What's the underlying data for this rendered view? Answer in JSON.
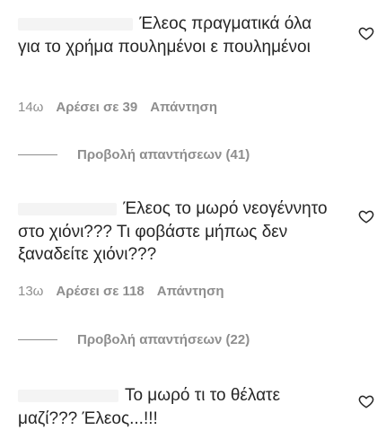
{
  "comments": [
    {
      "text": "Έλεος πραγματικά όλα για το χρήμα πουλημένοι ε πουλημένοι",
      "age": "14ω",
      "likes": "Αρέσει σε 39",
      "reply": "Απάντηση",
      "view_replies": "Προβολή απαντήσεων (41)"
    },
    {
      "text": "Έλεος το μωρό νεογέννητο στο χιόνι??? Τι φοβάστε μήπως δεν ξαναδείτε χιόνι???",
      "age": "13ω",
      "likes": "Αρέσει σε 118",
      "reply": "Απάντηση",
      "view_replies": "Προβολή απαντήσεων (22)"
    },
    {
      "text": "Το μωρό τι το θέλατε μαζί??? Έλεος...!!!"
    }
  ],
  "icons": {
    "like": "heart-icon"
  }
}
